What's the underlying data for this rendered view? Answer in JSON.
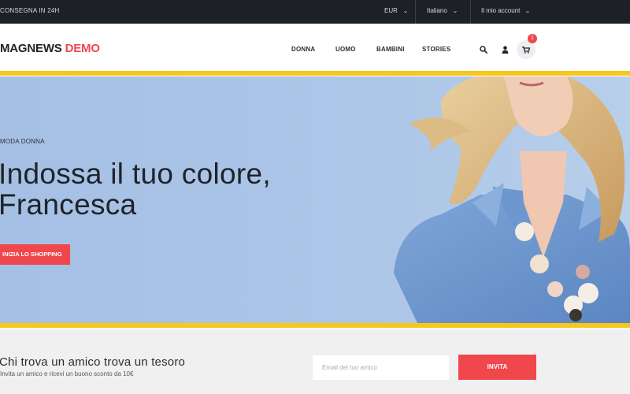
{
  "topbar": {
    "delivery": "CONSEGNA IN 24H",
    "currency": "EUR",
    "language": "Italiano",
    "account": "Il mio account"
  },
  "header": {
    "logo_main": "MAGNEWS",
    "logo_accent": "DEMO",
    "nav": [
      "DONNA",
      "UOMO",
      "BAMBINI",
      "STORIES"
    ],
    "cart_count": "1",
    "icons": [
      "search-icon",
      "user-icon",
      "cart-icon"
    ]
  },
  "hero": {
    "eyebrow": "MODA DONNA",
    "headline_line1": "Indossa il tuo colore,",
    "headline_line2": "Francesca",
    "cta": "INIZIA LO SHOPPING"
  },
  "referral": {
    "title": "Chi trova un amico trova un tesoro",
    "subtitle": "Invita un amico e ricevi un buono sconto da 10€",
    "email_placeholder": "Email del tuo amico",
    "button": "INVITA"
  },
  "colors": {
    "topbar_bg": "#1d2027",
    "accent_red": "#f0474d",
    "accent_yellow": "#f7c81c",
    "hero_bg": "#a9c3e6",
    "section_bg": "#f0f0f1"
  }
}
